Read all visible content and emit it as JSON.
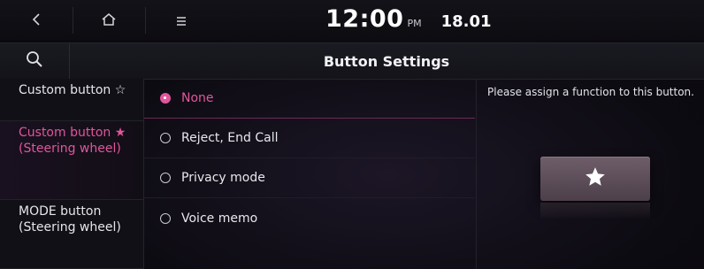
{
  "statusbar": {
    "back_icon": "chevron-left-icon",
    "home_icon": "home-icon",
    "menu_icon": "hamburger-menu-icon",
    "time": "12:00",
    "ampm": "PM",
    "date": "18.01"
  },
  "header": {
    "search_icon": "search-icon",
    "title": "Button Settings"
  },
  "leftmenu": {
    "items": [
      {
        "label": "Custom button ☆",
        "active": false
      },
      {
        "label": "Custom button ★ (Steering wheel)",
        "active": true
      },
      {
        "label": "MODE button (Steering wheel)",
        "active": false
      }
    ]
  },
  "options": {
    "items": [
      {
        "label": "None",
        "selected": true
      },
      {
        "label": "Reject, End Call",
        "selected": false
      },
      {
        "label": "Privacy mode",
        "selected": false
      },
      {
        "label": "Voice memo",
        "selected": false
      }
    ]
  },
  "info": {
    "text": "Please assign a function to this button.",
    "button_icon": "star-icon"
  },
  "colors": {
    "accent": "#e0569c",
    "background": "#0d0b12"
  }
}
